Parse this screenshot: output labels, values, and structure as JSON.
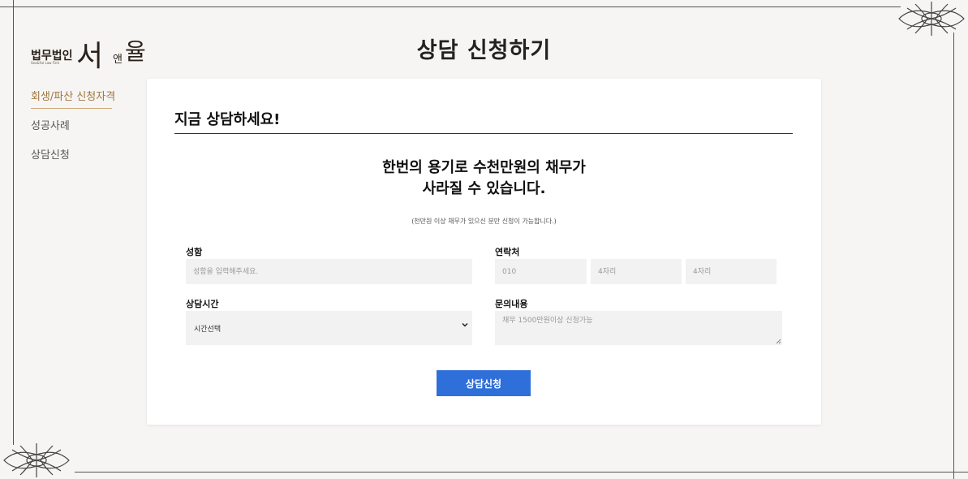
{
  "logo": {
    "firm_type": "법무법인",
    "name_part1": "서",
    "name_part2": "앤",
    "name_part3": "율",
    "english": "Seo&Yul Law Firm"
  },
  "page": {
    "title": "상담 신청하기"
  },
  "sidebar": {
    "items": [
      {
        "label": "회생/파산 신청자격",
        "active": true
      },
      {
        "label": "성공사례",
        "active": false
      },
      {
        "label": "상담신청",
        "active": false
      }
    ]
  },
  "form": {
    "heading": "지금 상담하세요!",
    "headline_line1": "한번의 용기로 수천만원의 채무가",
    "headline_line2": "사라질 수 있습니다.",
    "note": "(천만원 이상 채무가 있으신 분만 신청이 가능합니다.)",
    "name_label": "성함",
    "name_placeholder": "성함을 입력해주세요.",
    "contact_label": "연락처",
    "phone1_placeholder": "010",
    "phone2_placeholder": "4자리",
    "phone3_placeholder": "4자리",
    "time_label": "상담시간",
    "time_selected": "시간선택",
    "inquiry_label": "문의내용",
    "inquiry_placeholder": "채무 1500만원이상 신청가능",
    "submit_label": "상담신청"
  },
  "colors": {
    "accent": "#a0763e",
    "button": "#2f6fd9",
    "background": "#f6f5f4"
  }
}
